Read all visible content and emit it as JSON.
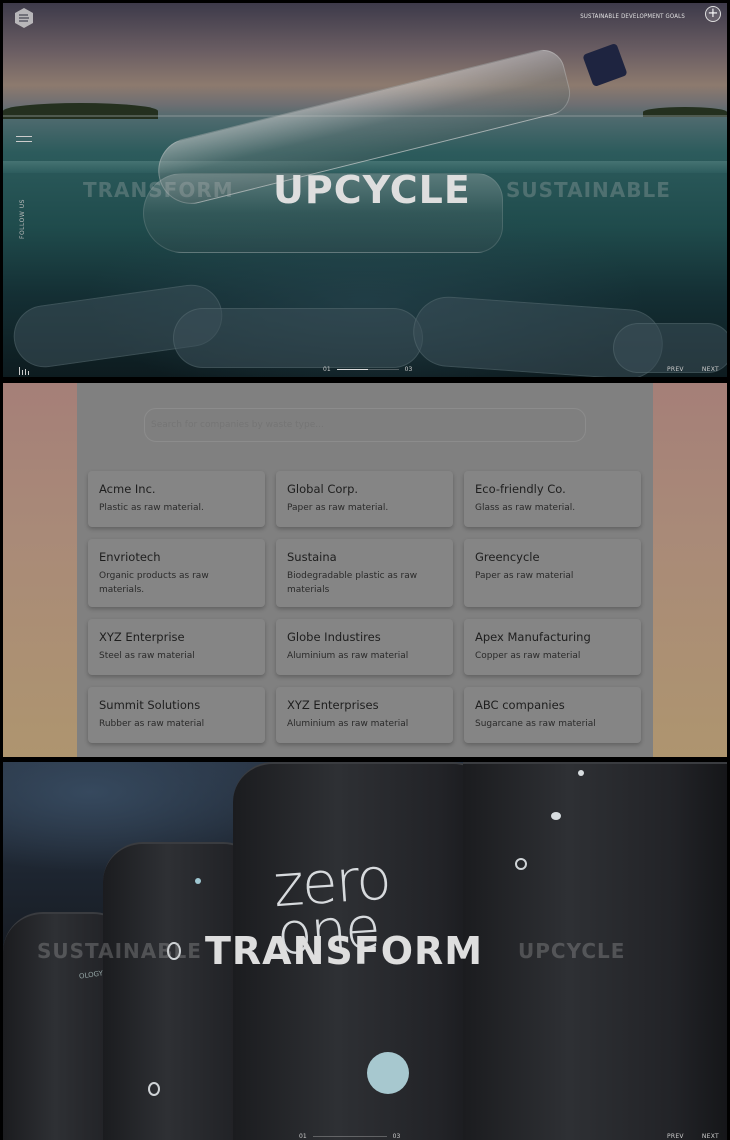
{
  "hero_top": {
    "header": {
      "sdg_link": "SUSTAINABLE DEVELOPMENT GOALS",
      "plus_label": "+"
    },
    "follow_label": "FOLLOW US",
    "words": {
      "left": "TRANSFORM",
      "center": "UPCYCLE",
      "right": "SUSTAINABLE"
    },
    "pager": {
      "current": "01",
      "total": "03",
      "progress": 0.5
    },
    "nav": {
      "prev": "PREV",
      "next": "NEXT"
    }
  },
  "directory": {
    "search_placeholder": "Search for companies by waste type...",
    "companies": [
      {
        "name": "Acme Inc.",
        "material": "Plastic as raw material."
      },
      {
        "name": "Global Corp.",
        "material": "Paper as raw material."
      },
      {
        "name": "Eco-friendly Co.",
        "material": "Glass as raw material."
      },
      {
        "name": "Envriotech",
        "material": "Organic products as raw materials."
      },
      {
        "name": "Sustaina",
        "material": "Biodegradable plastic as raw materials"
      },
      {
        "name": "Greencycle",
        "material": "Paper as raw material"
      },
      {
        "name": "XYZ Enterprise",
        "material": "Steel as raw material"
      },
      {
        "name": "Globe Industires",
        "material": "Aluminium as raw material"
      },
      {
        "name": "Apex Manufacturing",
        "material": "Copper as raw material"
      },
      {
        "name": "Summit Solutions",
        "material": "Rubber as raw material"
      },
      {
        "name": "XYZ Enterprises",
        "material": "Aluminium as raw material"
      },
      {
        "name": "ABC companies",
        "material": "Sugarcane as raw material"
      }
    ]
  },
  "hero_bottom": {
    "words": {
      "left": "SUSTAINABLE",
      "center": "TRANSFORM",
      "right": "UPCYCLE"
    },
    "silo_logo": "zero one",
    "silo_small_text": "OLOGY",
    "pager": {
      "current": "01",
      "total": "03"
    },
    "nav": {
      "prev": "PREV",
      "next": "NEXT"
    }
  }
}
